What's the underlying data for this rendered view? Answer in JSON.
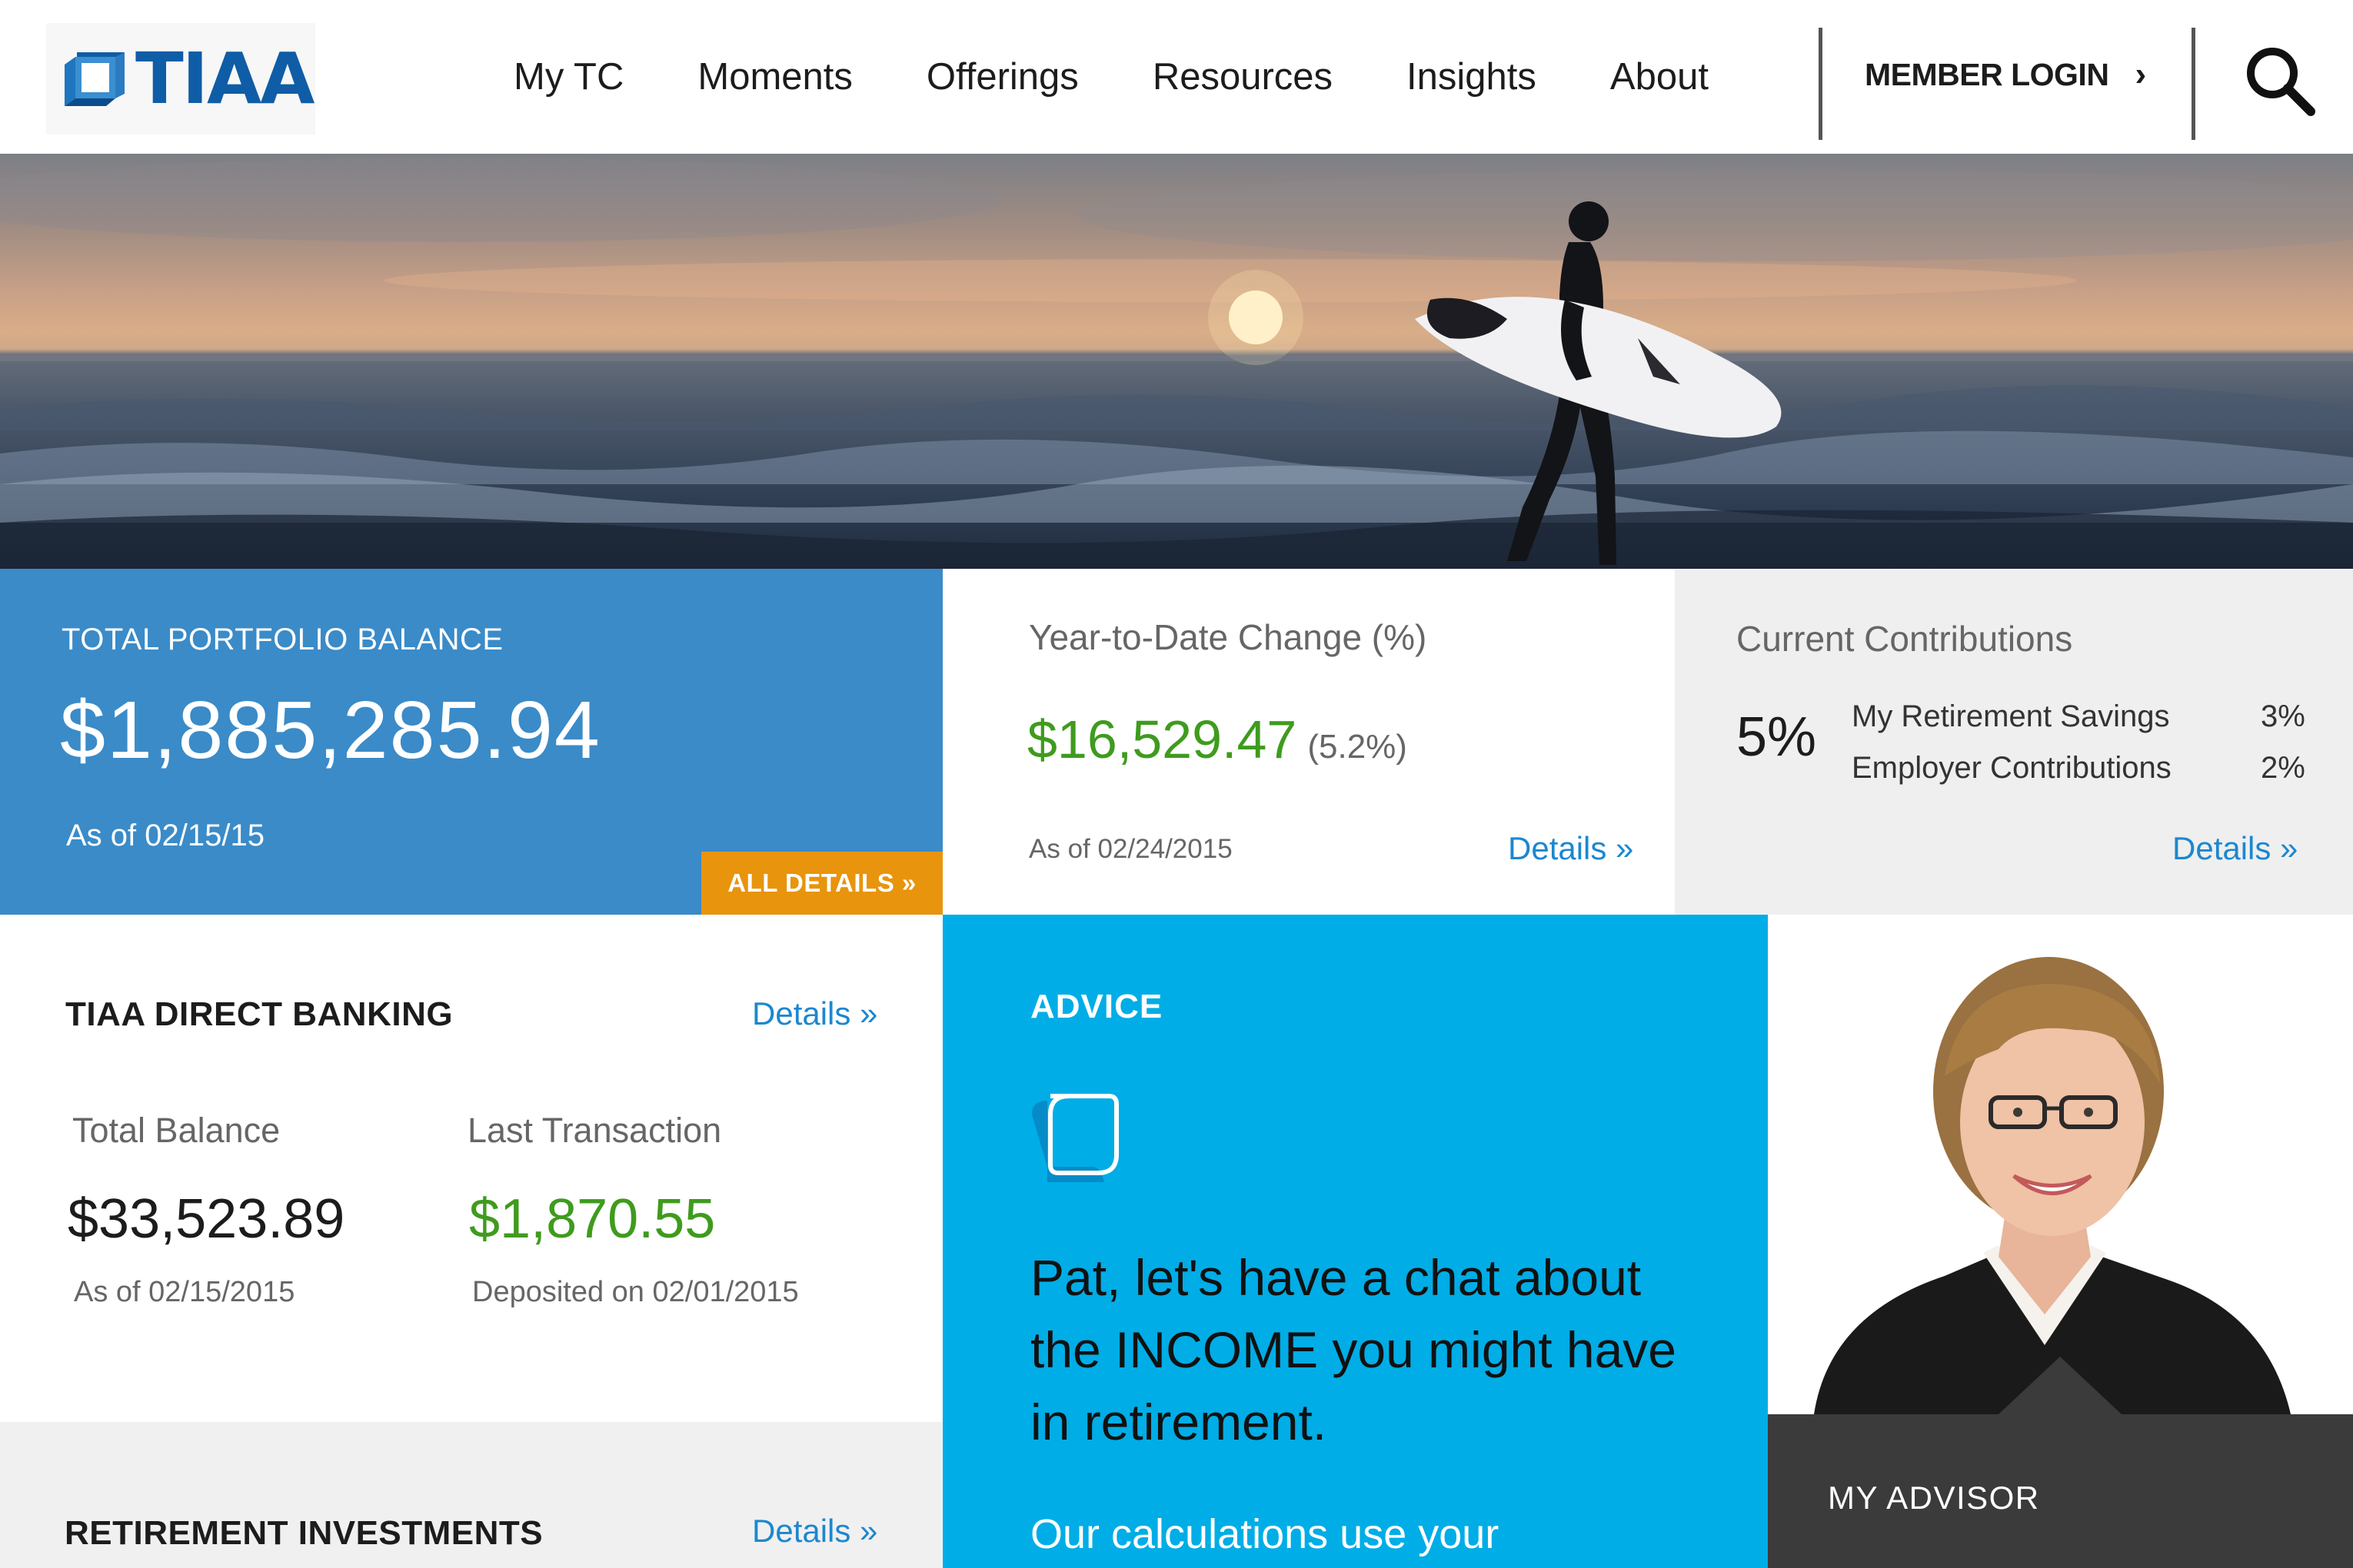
{
  "brand": {
    "name": "TIAA",
    "accent": "#0f5da6"
  },
  "nav": {
    "items": [
      "My TC",
      "Moments",
      "Offerings",
      "Resources",
      "Insights",
      "About"
    ],
    "login_label": "MEMBER LOGIN",
    "login_chevron": "›",
    "search_icon": "search-icon"
  },
  "portfolio": {
    "label": "TOTAL PORTFOLIO BALANCE",
    "value": "$1,885,285.94",
    "as_of": "As of 02/15/15",
    "button": "ALL DETAILS »"
  },
  "ytd": {
    "label": "Year-to-Date Change (%)",
    "value": "$16,529.47",
    "percent": "(5.2%)",
    "as_of": "As of 02/24/2015",
    "details": "Details »"
  },
  "contributions": {
    "label": "Current Contributions",
    "total": "5%",
    "rows": [
      {
        "label": "My Retirement Savings",
        "value": "3%"
      },
      {
        "label": "Employer Contributions",
        "value": "2%"
      }
    ],
    "details": "Details »"
  },
  "banking": {
    "title": "TIAA DIRECT BANKING",
    "details": "Details »",
    "total_label": "Total Balance",
    "total_value": "$33,523.89",
    "total_as_of": "As of 02/15/2015",
    "last_label": "Last Transaction",
    "last_value": "$1,870.55",
    "last_note": "Deposited on 02/01/2015"
  },
  "retirement": {
    "title": "RETIREMENT INVESTMENTS",
    "details": "Details »"
  },
  "advice": {
    "title": "ADVICE",
    "icon": "chat-bubble-icon",
    "message": "Pat, let's have a chat about the INCOME you might have in retirement.",
    "subtext": "Our calculations use your"
  },
  "advisor": {
    "label": "MY ADVISOR"
  },
  "colors": {
    "portfolio_bg": "#3a8bc8",
    "advice_bg": "#00ade6",
    "positive": "#3f9b1e",
    "link": "#1c87cf",
    "button": "#e8940c",
    "advisor_band": "#3b3b3b"
  }
}
